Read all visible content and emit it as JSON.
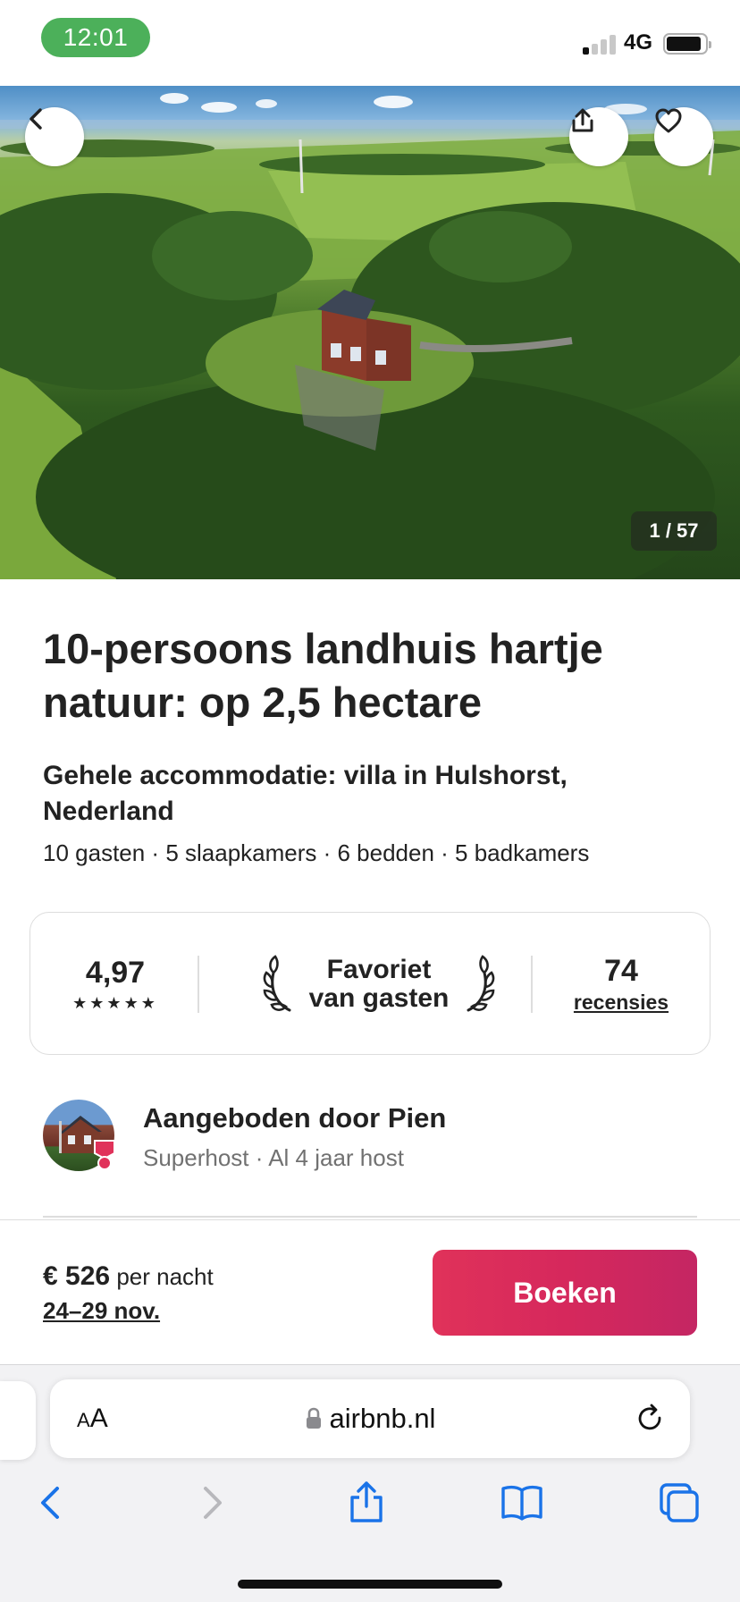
{
  "status_bar": {
    "time": "12:01",
    "network": "4G",
    "time_pill_color": "#4cb05a"
  },
  "hero": {
    "photo_counter": "1 / 57",
    "icons": [
      "chevron-left-icon",
      "share-icon",
      "heart-icon"
    ]
  },
  "listing": {
    "title": "10-persoons landhuis hartje natuur: op 2,5 hectare",
    "subtitle": "Gehele accommodatie: villa in Hulshorst, Nederland",
    "details": "10 gasten · 5 slaapkamers · 6 bedden · 5 badkamers"
  },
  "rating": {
    "score": "4,97",
    "stars": "★★★★★",
    "badge_line1": "Favoriet",
    "badge_line2": "van gasten",
    "review_count": "74",
    "review_label": "recensies"
  },
  "host": {
    "name": "Aangeboden door Pien",
    "meta": "Superhost · Al 4 jaar host",
    "badge_color": "#e0325a"
  },
  "booking": {
    "price": "€ 526",
    "price_unit": "per nacht",
    "dates": "24–29 nov.",
    "book_label": "Boeken",
    "accent_color": "#e0325a"
  },
  "browser": {
    "aa_large": "A",
    "aa_small": "A",
    "url": "airbnb.nl",
    "toolbar_icons": [
      "back-icon",
      "forward-icon",
      "share-icon",
      "bookmarks-icon",
      "tabs-icon"
    ],
    "tint_color": "#1a73e8"
  }
}
